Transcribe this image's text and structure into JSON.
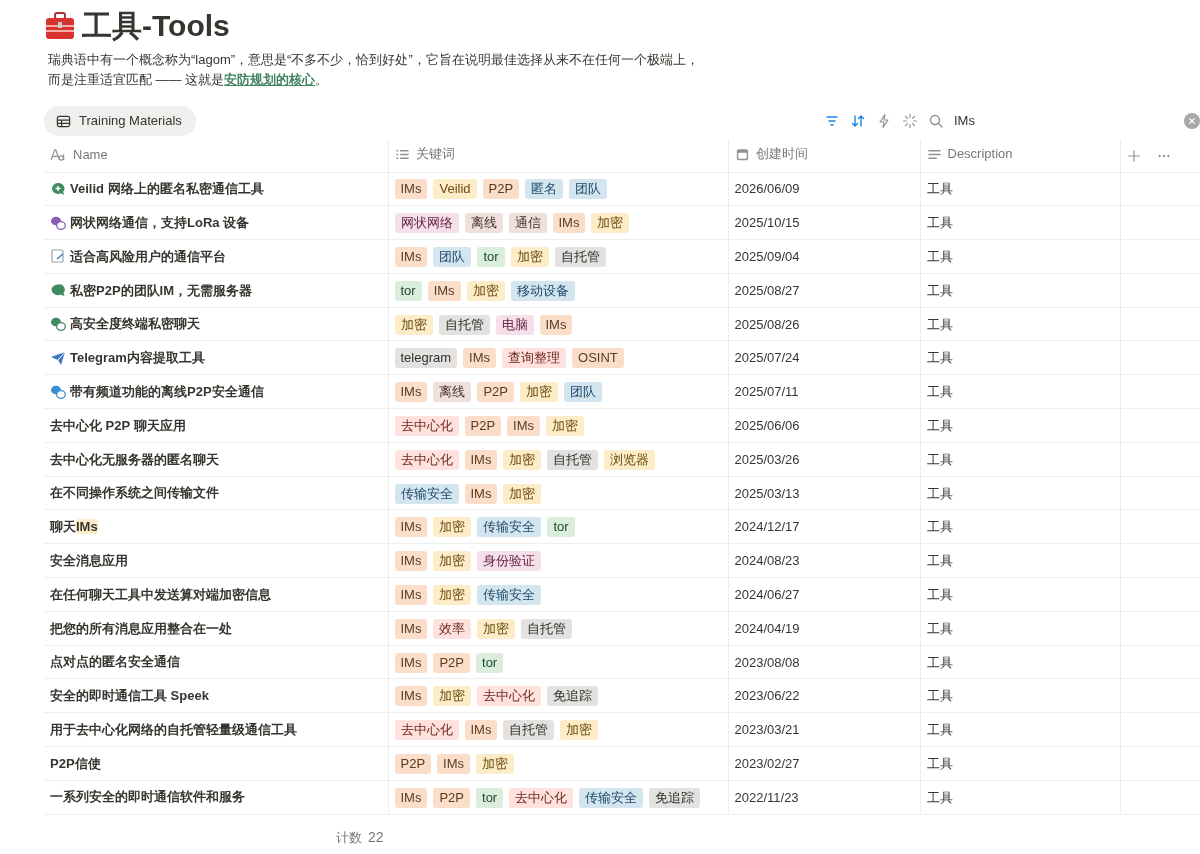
{
  "page": {
    "title": "工具-Tools",
    "description": {
      "line1": "瑞典语中有一个概念称为“lagom”，意思是“不多不少，恰到好处”，它旨在说明最佳选择从来不在任何一个极端上，",
      "line2": "而是注重适宜匹配  —— 这就是",
      "link": "安防规划的核心",
      "after": "。"
    }
  },
  "view_tab": {
    "label": "Training Materials",
    "selected": true
  },
  "toolbar": {
    "filter_active": true,
    "sort_active": true,
    "search": {
      "value": "IMs"
    }
  },
  "table": {
    "columns": [
      {
        "label": "Name",
        "kind": "title"
      },
      {
        "label": "关键词",
        "kind": "multi"
      },
      {
        "label": "创建时间",
        "kind": "date"
      },
      {
        "label": "Description",
        "kind": "text"
      }
    ],
    "rows": [
      {
        "name": "Veilid 网络上的匿名私密通信工具",
        "tags": [
          {
            "label": "IMs",
            "color": "#fadec9"
          },
          {
            "label": "Veilid",
            "color": "#fdecc8"
          },
          {
            "label": "P2P",
            "color": "#fadec9"
          },
          {
            "label": "匿名",
            "color": "#d3e5ef"
          },
          {
            "label": "团队",
            "color": "#d3e5ef"
          }
        ],
        "date": "2026/06/09",
        "description": "工具"
      },
      {
        "name": "网状网络通信，支持LoRa 设备",
        "tags": [
          {
            "label": "网状网络",
            "color": "#f5e0e9"
          },
          {
            "label": "离线",
            "color": "#eee0da"
          },
          {
            "label": "通信",
            "color": "#eee0da"
          },
          {
            "label": "IMs",
            "color": "#fadec9"
          },
          {
            "label": "加密",
            "color": "#fdecc8"
          }
        ],
        "date": "2025/10/15",
        "description": "工具"
      },
      {
        "name": "适合高风险用户的通信平台",
        "tags": [
          {
            "label": "IMs",
            "color": "#fadec9"
          },
          {
            "label": "团队",
            "color": "#d3e5ef"
          },
          {
            "label": "tor",
            "color": "#dbeddb"
          },
          {
            "label": "加密",
            "color": "#fdecc8"
          },
          {
            "label": "自托管",
            "color": "#e3e2e0"
          }
        ],
        "date": "2025/09/04",
        "description": "工具"
      },
      {
        "name": "私密P2P的团队IM，无需服务器",
        "tags": [
          {
            "label": "tor",
            "color": "#dbeddb"
          },
          {
            "label": "IMs",
            "color": "#fadec9"
          },
          {
            "label": "加密",
            "color": "#fdecc8"
          },
          {
            "label": "移动设备",
            "color": "#d3e5ef"
          }
        ],
        "date": "2025/08/27",
        "description": "工具"
      },
      {
        "name": "高安全度终端私密聊天",
        "tags": [
          {
            "label": "加密",
            "color": "#fdecc8"
          },
          {
            "label": "自托管",
            "color": "#e3e2e0"
          },
          {
            "label": "电脑",
            "color": "#f5e0e9"
          },
          {
            "label": "IMs",
            "color": "#fadec9"
          }
        ],
        "date": "2025/08/26",
        "description": "工具"
      },
      {
        "name": "Telegram内容提取工具",
        "tags": [
          {
            "label": "telegram",
            "color": "#e3e2e0"
          },
          {
            "label": "IMs",
            "color": "#fadec9"
          },
          {
            "label": "查询整理",
            "color": "#ffe2dd"
          },
          {
            "label": "OSINT",
            "color": "#fadec9"
          }
        ],
        "date": "2025/07/24",
        "description": "工具"
      },
      {
        "name": "带有频道功能的离线P2P安全通信",
        "tags": [
          {
            "label": "IMs",
            "color": "#fadec9"
          },
          {
            "label": "离线",
            "color": "#eee0da"
          },
          {
            "label": "P2P",
            "color": "#fadec9"
          },
          {
            "label": "加密",
            "color": "#fdecc8"
          },
          {
            "label": "团队",
            "color": "#d3e5ef"
          }
        ],
        "date": "2025/07/11",
        "description": "工具"
      },
      {
        "name": "去中心化 P2P 聊天应用",
        "tags": [
          {
            "label": "去中心化",
            "color": "#ffe2dd"
          },
          {
            "label": "P2P",
            "color": "#fadec9"
          },
          {
            "label": "IMs",
            "color": "#fadec9"
          },
          {
            "label": "加密",
            "color": "#fdecc8"
          }
        ],
        "date": "2025/06/06",
        "description": "工具"
      },
      {
        "name": "去中心化无服务器的匿名聊天",
        "tags": [
          {
            "label": "去中心化",
            "color": "#ffe2dd"
          },
          {
            "label": "IMs",
            "color": "#fadec9"
          },
          {
            "label": "加密",
            "color": "#fdecc8"
          },
          {
            "label": "自托管",
            "color": "#e3e2e0"
          },
          {
            "label": "浏览器",
            "color": "#fdecc8"
          }
        ],
        "date": "2025/03/26",
        "description": "工具"
      },
      {
        "name": "在不同操作系统之间传输文件",
        "tags": [
          {
            "label": "传输安全",
            "color": "#d3e5ef"
          },
          {
            "label": "IMs",
            "color": "#fadec9"
          },
          {
            "label": "加密",
            "color": "#fdecc8"
          }
        ],
        "date": "2025/03/13",
        "description": "工具"
      },
      {
        "name": "聊天",
        "match": "IMs",
        "tags": [
          {
            "label": "IMs",
            "color": "#fadec9"
          },
          {
            "label": "加密",
            "color": "#fdecc8"
          },
          {
            "label": "传输安全",
            "color": "#d3e5ef"
          },
          {
            "label": "tor",
            "color": "#dbeddb"
          }
        ],
        "date": "2024/12/17",
        "description": "工具"
      },
      {
        "name": "安全消息应用",
        "tags": [
          {
            "label": "IMs",
            "color": "#fadec9"
          },
          {
            "label": "加密",
            "color": "#fdecc8"
          },
          {
            "label": "身份验证",
            "color": "#f5e0e9"
          }
        ],
        "date": "2024/08/23",
        "description": "工具"
      },
      {
        "name": "在任何聊天工具中发送算对端加密信息",
        "tags": [
          {
            "label": "IMs",
            "color": "#fadec9"
          },
          {
            "label": "加密",
            "color": "#fdecc8"
          },
          {
            "label": "传输安全",
            "color": "#d3e5ef"
          }
        ],
        "date": "2024/06/27",
        "description": "工具"
      },
      {
        "name": "把您的所有消息应用整合在一处",
        "tags": [
          {
            "label": "IMs",
            "color": "#fadec9"
          },
          {
            "label": "效率",
            "color": "#ffe2dd"
          },
          {
            "label": "加密",
            "color": "#fdecc8"
          },
          {
            "label": "自托管",
            "color": "#e3e2e0"
          }
        ],
        "date": "2024/04/19",
        "description": "工具"
      },
      {
        "name": "点对点的匿名安全通信",
        "tags": [
          {
            "label": "IMs",
            "color": "#fadec9"
          },
          {
            "label": "P2P",
            "color": "#fadec9"
          },
          {
            "label": "tor",
            "color": "#dbeddb"
          }
        ],
        "date": "2023/08/08",
        "description": "工具"
      },
      {
        "name": "安全的即时通信工具 Speek",
        "tags": [
          {
            "label": "IMs",
            "color": "#fadec9"
          },
          {
            "label": "加密",
            "color": "#fdecc8"
          },
          {
            "label": "去中心化",
            "color": "#ffe2dd"
          },
          {
            "label": "免追踪",
            "color": "#e3e2e0"
          }
        ],
        "date": "2023/06/22",
        "description": "工具"
      },
      {
        "name": "用于去中心化网络的自托管轻量级通信工具",
        "tags": [
          {
            "label": "去中心化",
            "color": "#ffe2dd"
          },
          {
            "label": "IMs",
            "color": "#fadec9"
          },
          {
            "label": "自托管",
            "color": "#e3e2e0"
          },
          {
            "label": "加密",
            "color": "#fdecc8"
          }
        ],
        "date": "2023/03/21",
        "description": "工具"
      },
      {
        "name": "P2P信使",
        "tags": [
          {
            "label": "P2P",
            "color": "#fadec9"
          },
          {
            "label": "IMs",
            "color": "#fadec9"
          },
          {
            "label": "加密",
            "color": "#fdecc8"
          }
        ],
        "date": "2023/02/27",
        "description": "工具"
      },
      {
        "name": "一系列安全的即时通信软件和服务",
        "tags": [
          {
            "label": "IMs",
            "color": "#fadec9"
          },
          {
            "label": "P2P",
            "color": "#fadec9"
          },
          {
            "label": "tor",
            "color": "#dbeddb"
          },
          {
            "label": "去中心化",
            "color": "#ffe2dd"
          },
          {
            "label": "传输安全",
            "color": "#d3e5ef"
          },
          {
            "label": "免追踪",
            "color": "#e3e2e0"
          }
        ],
        "date": "2022/11/23",
        "description": "工具"
      }
    ]
  },
  "footer": {
    "label": "计数",
    "count": "22"
  }
}
